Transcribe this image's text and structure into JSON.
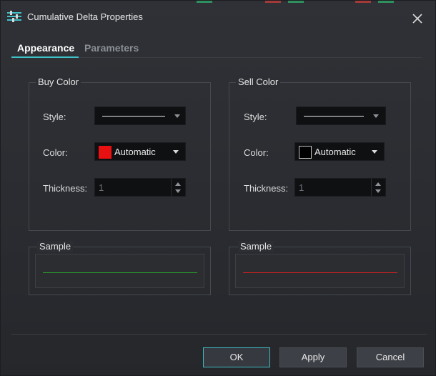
{
  "window": {
    "title": "Cumulative Delta Properties"
  },
  "tabs": [
    {
      "label": "Appearance",
      "active": true
    },
    {
      "label": "Parameters",
      "active": false
    }
  ],
  "buy": {
    "group_label": "Buy Color",
    "style_label": "Style:",
    "color_label": "Color:",
    "color_value": "Automatic",
    "color_swatch": "#e81010",
    "thickness_label": "Thickness:",
    "thickness_value": "1",
    "sample_label": "Sample",
    "sample_color": "#2aa02a"
  },
  "sell": {
    "group_label": "Sell Color",
    "style_label": "Style:",
    "color_label": "Color:",
    "color_value": "Automatic",
    "color_swatch": "#000000",
    "thickness_label": "Thickness:",
    "thickness_value": "1",
    "sample_label": "Sample",
    "sample_color": "#d42020"
  },
  "buttons": {
    "ok": "OK",
    "apply": "Apply",
    "cancel": "Cancel"
  },
  "colors": {
    "accent": "#3fc1c9",
    "background": "#2c2e33",
    "field": "#0f1012"
  },
  "icons": {
    "app": "settings-sliders-icon",
    "close": "close-icon",
    "dropdown": "chevron-down-icon",
    "spin_up": "spin-up-icon",
    "spin_down": "spin-down-icon"
  }
}
